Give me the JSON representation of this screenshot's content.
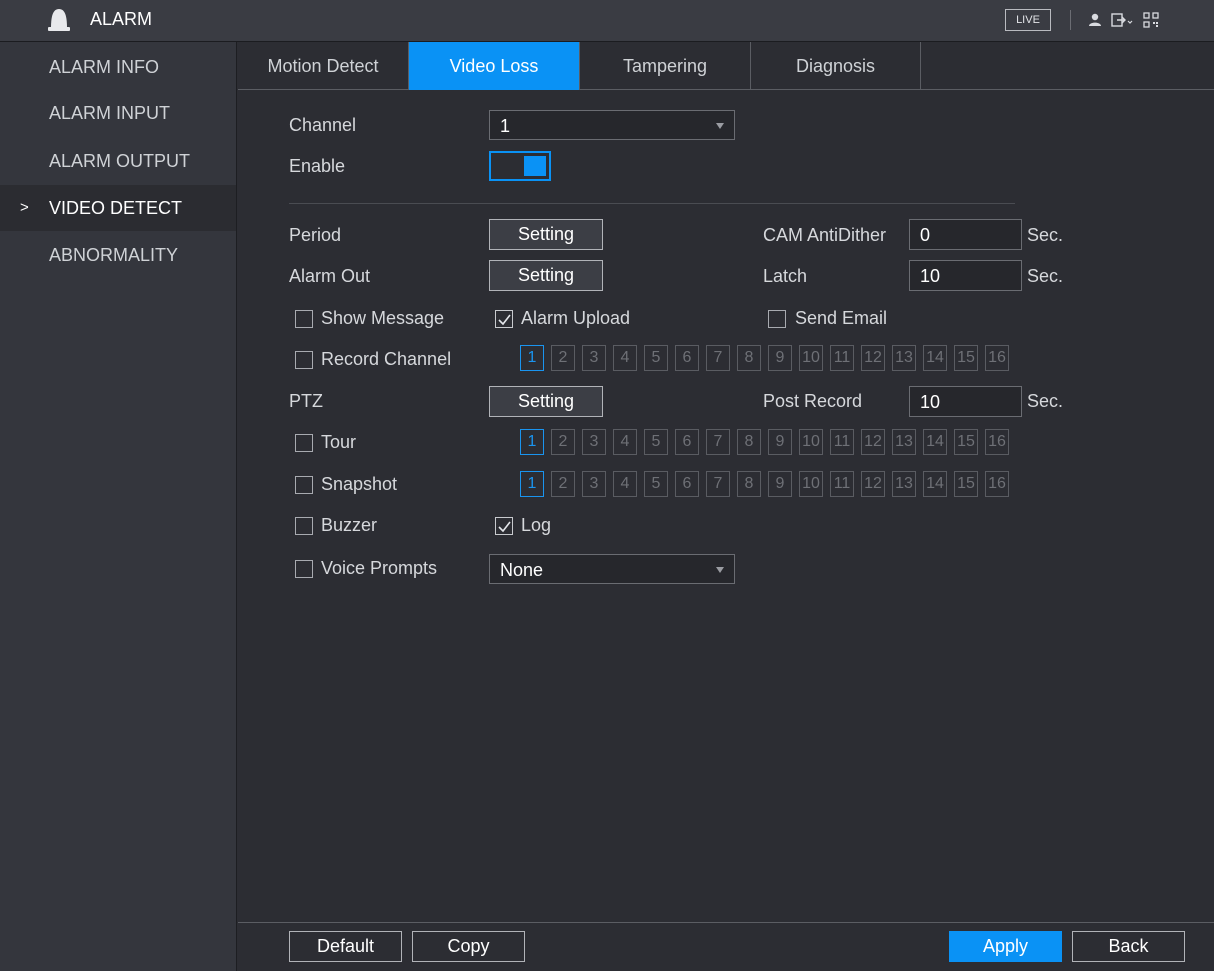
{
  "header": {
    "title": "ALARM",
    "live_label": "LIVE",
    "icons": [
      "alarm-bell-icon",
      "user-icon",
      "logout-icon",
      "qr-code-icon"
    ]
  },
  "sidebar": {
    "items": [
      {
        "label": "ALARM INFO"
      },
      {
        "label": "ALARM INPUT"
      },
      {
        "label": "ALARM OUTPUT"
      },
      {
        "label": "VIDEO DETECT",
        "active": true
      },
      {
        "label": "ABNORMALITY"
      }
    ],
    "active_marker": ">"
  },
  "tabs": [
    {
      "label": "Motion Detect"
    },
    {
      "label": "Video Loss",
      "active": true
    },
    {
      "label": "Tampering"
    },
    {
      "label": "Diagnosis"
    }
  ],
  "form": {
    "channel_label": "Channel",
    "channel_value": "1",
    "enable_label": "Enable",
    "enable_on": true,
    "period_label": "Period",
    "alarm_out_label": "Alarm Out",
    "ptz_label": "PTZ",
    "setting_label": "Setting",
    "cam_antidither_label": "CAM AntiDither",
    "cam_antidither_value": "0",
    "latch_label": "Latch",
    "latch_value": "10",
    "post_record_label": "Post Record",
    "post_record_value": "10",
    "unit_sec": "Sec.",
    "show_message_label": "Show Message",
    "show_message_checked": false,
    "alarm_upload_label": "Alarm Upload",
    "alarm_upload_checked": true,
    "send_email_label": "Send Email",
    "send_email_checked": false,
    "record_channel_label": "Record Channel",
    "record_channel_checked": false,
    "tour_label": "Tour",
    "tour_checked": false,
    "snapshot_label": "Snapshot",
    "snapshot_checked": false,
    "buzzer_label": "Buzzer",
    "buzzer_checked": false,
    "log_label": "Log",
    "log_checked": true,
    "voice_prompts_label": "Voice Prompts",
    "voice_prompts_checked": false,
    "voice_prompts_value": "None",
    "channels": [
      "1",
      "2",
      "3",
      "4",
      "5",
      "6",
      "7",
      "8",
      "9",
      "10",
      "11",
      "12",
      "13",
      "14",
      "15",
      "16"
    ],
    "selected_channel": "1"
  },
  "footer": {
    "default_label": "Default",
    "copy_label": "Copy",
    "apply_label": "Apply",
    "back_label": "Back"
  },
  "colors": {
    "accent": "#0a92f5",
    "background": "#2c2d33",
    "sidebar": "#34363d",
    "topbar": "#3a3c43"
  }
}
